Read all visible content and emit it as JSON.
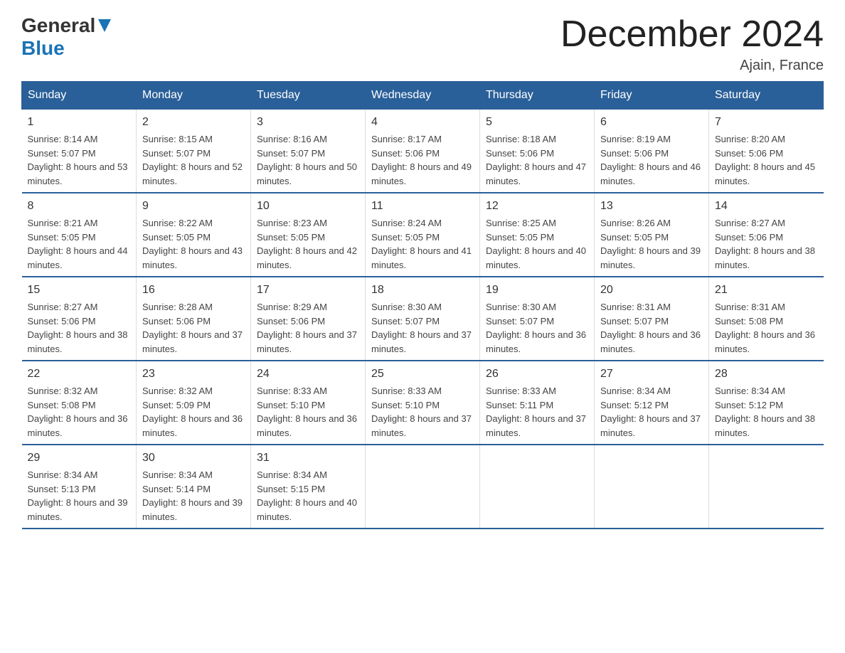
{
  "header": {
    "logo_general": "General",
    "logo_blue": "Blue",
    "month_title": "December 2024",
    "location": "Ajain, France"
  },
  "weekdays": [
    "Sunday",
    "Monday",
    "Tuesday",
    "Wednesday",
    "Thursday",
    "Friday",
    "Saturday"
  ],
  "weeks": [
    [
      {
        "day": "1",
        "sunrise": "8:14 AM",
        "sunset": "5:07 PM",
        "daylight": "8 hours and 53 minutes."
      },
      {
        "day": "2",
        "sunrise": "8:15 AM",
        "sunset": "5:07 PM",
        "daylight": "8 hours and 52 minutes."
      },
      {
        "day": "3",
        "sunrise": "8:16 AM",
        "sunset": "5:07 PM",
        "daylight": "8 hours and 50 minutes."
      },
      {
        "day": "4",
        "sunrise": "8:17 AM",
        "sunset": "5:06 PM",
        "daylight": "8 hours and 49 minutes."
      },
      {
        "day": "5",
        "sunrise": "8:18 AM",
        "sunset": "5:06 PM",
        "daylight": "8 hours and 47 minutes."
      },
      {
        "day": "6",
        "sunrise": "8:19 AM",
        "sunset": "5:06 PM",
        "daylight": "8 hours and 46 minutes."
      },
      {
        "day": "7",
        "sunrise": "8:20 AM",
        "sunset": "5:06 PM",
        "daylight": "8 hours and 45 minutes."
      }
    ],
    [
      {
        "day": "8",
        "sunrise": "8:21 AM",
        "sunset": "5:05 PM",
        "daylight": "8 hours and 44 minutes."
      },
      {
        "day": "9",
        "sunrise": "8:22 AM",
        "sunset": "5:05 PM",
        "daylight": "8 hours and 43 minutes."
      },
      {
        "day": "10",
        "sunrise": "8:23 AM",
        "sunset": "5:05 PM",
        "daylight": "8 hours and 42 minutes."
      },
      {
        "day": "11",
        "sunrise": "8:24 AM",
        "sunset": "5:05 PM",
        "daylight": "8 hours and 41 minutes."
      },
      {
        "day": "12",
        "sunrise": "8:25 AM",
        "sunset": "5:05 PM",
        "daylight": "8 hours and 40 minutes."
      },
      {
        "day": "13",
        "sunrise": "8:26 AM",
        "sunset": "5:05 PM",
        "daylight": "8 hours and 39 minutes."
      },
      {
        "day": "14",
        "sunrise": "8:27 AM",
        "sunset": "5:06 PM",
        "daylight": "8 hours and 38 minutes."
      }
    ],
    [
      {
        "day": "15",
        "sunrise": "8:27 AM",
        "sunset": "5:06 PM",
        "daylight": "8 hours and 38 minutes."
      },
      {
        "day": "16",
        "sunrise": "8:28 AM",
        "sunset": "5:06 PM",
        "daylight": "8 hours and 37 minutes."
      },
      {
        "day": "17",
        "sunrise": "8:29 AM",
        "sunset": "5:06 PM",
        "daylight": "8 hours and 37 minutes."
      },
      {
        "day": "18",
        "sunrise": "8:30 AM",
        "sunset": "5:07 PM",
        "daylight": "8 hours and 37 minutes."
      },
      {
        "day": "19",
        "sunrise": "8:30 AM",
        "sunset": "5:07 PM",
        "daylight": "8 hours and 36 minutes."
      },
      {
        "day": "20",
        "sunrise": "8:31 AM",
        "sunset": "5:07 PM",
        "daylight": "8 hours and 36 minutes."
      },
      {
        "day": "21",
        "sunrise": "8:31 AM",
        "sunset": "5:08 PM",
        "daylight": "8 hours and 36 minutes."
      }
    ],
    [
      {
        "day": "22",
        "sunrise": "8:32 AM",
        "sunset": "5:08 PM",
        "daylight": "8 hours and 36 minutes."
      },
      {
        "day": "23",
        "sunrise": "8:32 AM",
        "sunset": "5:09 PM",
        "daylight": "8 hours and 36 minutes."
      },
      {
        "day": "24",
        "sunrise": "8:33 AM",
        "sunset": "5:10 PM",
        "daylight": "8 hours and 36 minutes."
      },
      {
        "day": "25",
        "sunrise": "8:33 AM",
        "sunset": "5:10 PM",
        "daylight": "8 hours and 37 minutes."
      },
      {
        "day": "26",
        "sunrise": "8:33 AM",
        "sunset": "5:11 PM",
        "daylight": "8 hours and 37 minutes."
      },
      {
        "day": "27",
        "sunrise": "8:34 AM",
        "sunset": "5:12 PM",
        "daylight": "8 hours and 37 minutes."
      },
      {
        "day": "28",
        "sunrise": "8:34 AM",
        "sunset": "5:12 PM",
        "daylight": "8 hours and 38 minutes."
      }
    ],
    [
      {
        "day": "29",
        "sunrise": "8:34 AM",
        "sunset": "5:13 PM",
        "daylight": "8 hours and 39 minutes."
      },
      {
        "day": "30",
        "sunrise": "8:34 AM",
        "sunset": "5:14 PM",
        "daylight": "8 hours and 39 minutes."
      },
      {
        "day": "31",
        "sunrise": "8:34 AM",
        "sunset": "5:15 PM",
        "daylight": "8 hours and 40 minutes."
      },
      null,
      null,
      null,
      null
    ]
  ],
  "labels": {
    "sunrise": "Sunrise:",
    "sunset": "Sunset:",
    "daylight": "Daylight:"
  }
}
